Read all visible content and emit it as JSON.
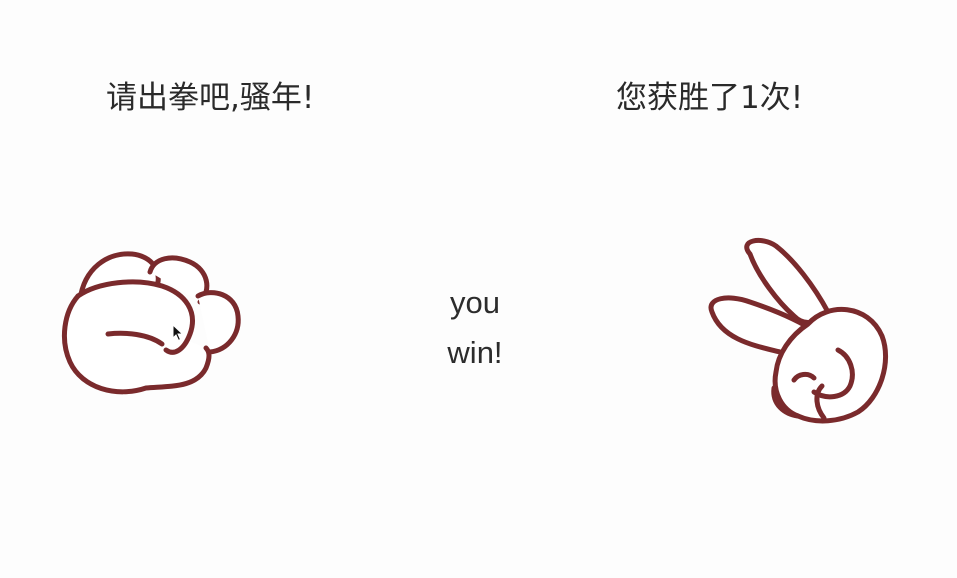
{
  "game": {
    "prompt": "请出拳吧,骚年!",
    "score": "您获胜了1次!",
    "result_line1": "you",
    "result_line2": "win!"
  },
  "player_hand": {
    "gesture": "rock",
    "icon": "fist-icon"
  },
  "computer_hand": {
    "gesture": "scissors",
    "icon": "victory-hand-icon"
  },
  "colors": {
    "hand_stroke": "#7a2a2c",
    "hand_fill": "#ffffff",
    "text": "#2b2b2b",
    "background": "#fdfdfd"
  }
}
